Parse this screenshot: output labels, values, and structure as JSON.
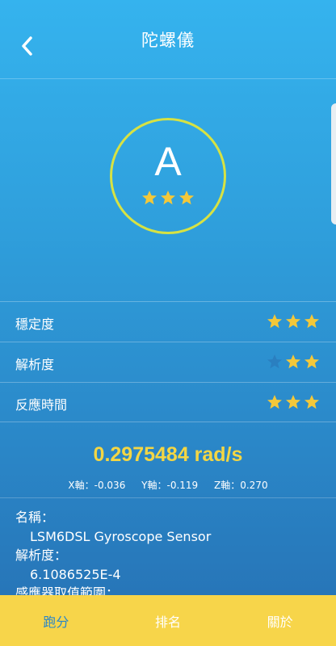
{
  "header": {
    "title": "陀螺儀",
    "back_icon": "chevron-left-icon"
  },
  "grade": {
    "letter": "A",
    "stars": 3,
    "max_stars": 3
  },
  "metrics": [
    {
      "label": "穩定度",
      "stars": 3,
      "max_stars": 3
    },
    {
      "label": "解析度",
      "stars": 2,
      "max_stars": 3
    },
    {
      "label": "反應時間",
      "stars": 3,
      "max_stars": 3
    }
  ],
  "reading": {
    "value": "0.2975484 rad/s",
    "x": "X軸：-0.036",
    "y": "Y軸：-0.119",
    "z": "Z軸：0.270"
  },
  "info": {
    "name_label": "名稱：",
    "name_value": "LSM6DSL Gyroscope Sensor",
    "resolution_label": "解析度：",
    "resolution_value": "6.1086525E-4",
    "range_label": "感應器取值範圍："
  },
  "tabs": [
    {
      "label": "跑分",
      "active": true
    },
    {
      "label": "排名",
      "active": false
    },
    {
      "label": "關於",
      "active": false
    }
  ],
  "colors": {
    "star_on": "#f3c83a",
    "star_off": "#2a7fc0",
    "ring": "#d7e243",
    "accent": "#f3d644",
    "tabbar": "#f7d54a"
  }
}
